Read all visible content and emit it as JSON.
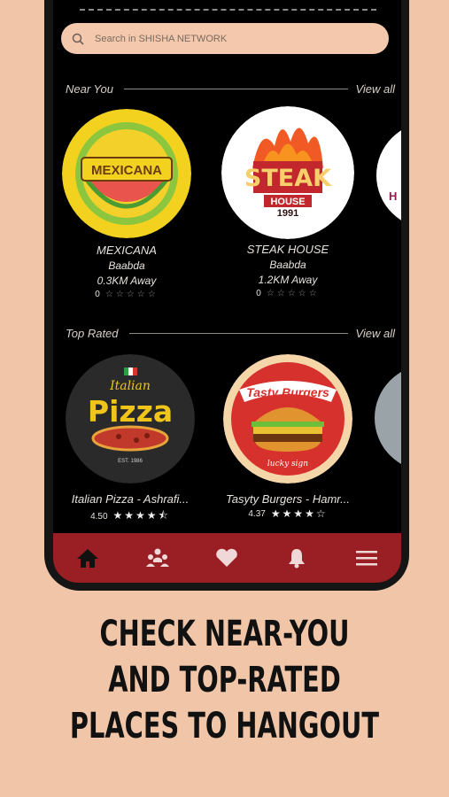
{
  "search": {
    "placeholder": "Search in SHISHA NETWORK"
  },
  "near_you": {
    "title": "Near You",
    "view_all": "View all",
    "items": [
      {
        "name": "MEXICANA",
        "area": "Baabda",
        "distance": "0.3KM Away",
        "rating": "0",
        "stars": "☆☆☆☆☆",
        "logo_text": "MEXICANA"
      },
      {
        "name": "STEAK HOUSE",
        "area": "Baabda",
        "distance": "1.2KM Away",
        "rating": "0",
        "stars": "☆☆☆☆☆",
        "logo_text": "STEAK",
        "logo_text2": "HOUSE",
        "logo_text3": "1991"
      },
      {
        "logo_text": "H"
      }
    ]
  },
  "top_rated": {
    "title": "Top Rated",
    "view_all": "View all",
    "items": [
      {
        "name": "Italian Pizza - Ashrafi...",
        "rating": "4.50",
        "stars": "★★★★⯪",
        "logo_text": "Italian",
        "logo_text2": "Pizza",
        "logo_text3": "EST. 1986"
      },
      {
        "name": "Tasyty Burgers - Hamr...",
        "rating": "4.37",
        "stars": "★★★★☆",
        "logo_text": "Tasty Burgers",
        "logo_text2": "lucky sign"
      }
    ]
  },
  "tabbar": [
    "home-icon",
    "groups-icon",
    "favorites-icon",
    "notifications-icon",
    "menu-icon"
  ],
  "caption": [
    "CHECK NEAR-YOU",
    "AND TOP-RATED",
    "PLACES TO HANGOUT"
  ],
  "colors": {
    "background": "#f1c6a8",
    "tabbar": "#9a1f24",
    "screen": "#000000"
  }
}
